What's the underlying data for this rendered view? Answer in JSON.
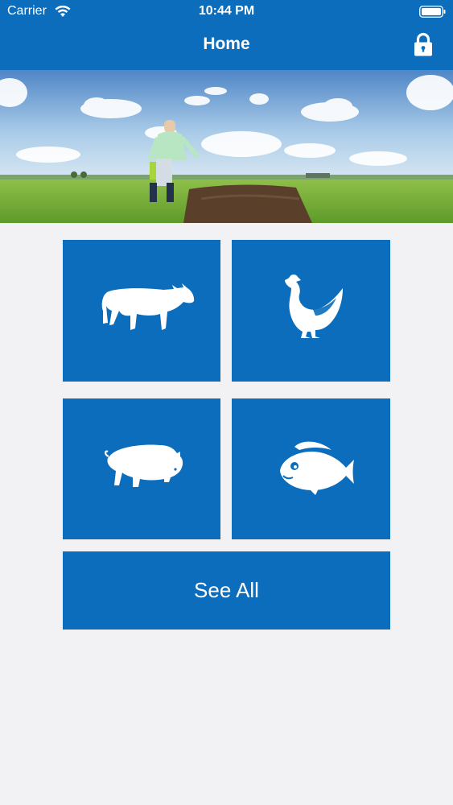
{
  "status_bar": {
    "carrier": "Carrier",
    "time": "10:44 PM"
  },
  "nav": {
    "title": "Home",
    "right_icon": "lock-icon"
  },
  "banner": {
    "description_icon": "farm-banner-image"
  },
  "tiles": [
    {
      "icon": "cow-icon"
    },
    {
      "icon": "chicken-icon"
    },
    {
      "icon": "pig-icon"
    },
    {
      "icon": "fish-icon"
    }
  ],
  "see_all": {
    "label": "See All"
  },
  "colors": {
    "primary": "#0b6dbb",
    "background": "#f2f2f4",
    "on_primary": "#ffffff"
  }
}
